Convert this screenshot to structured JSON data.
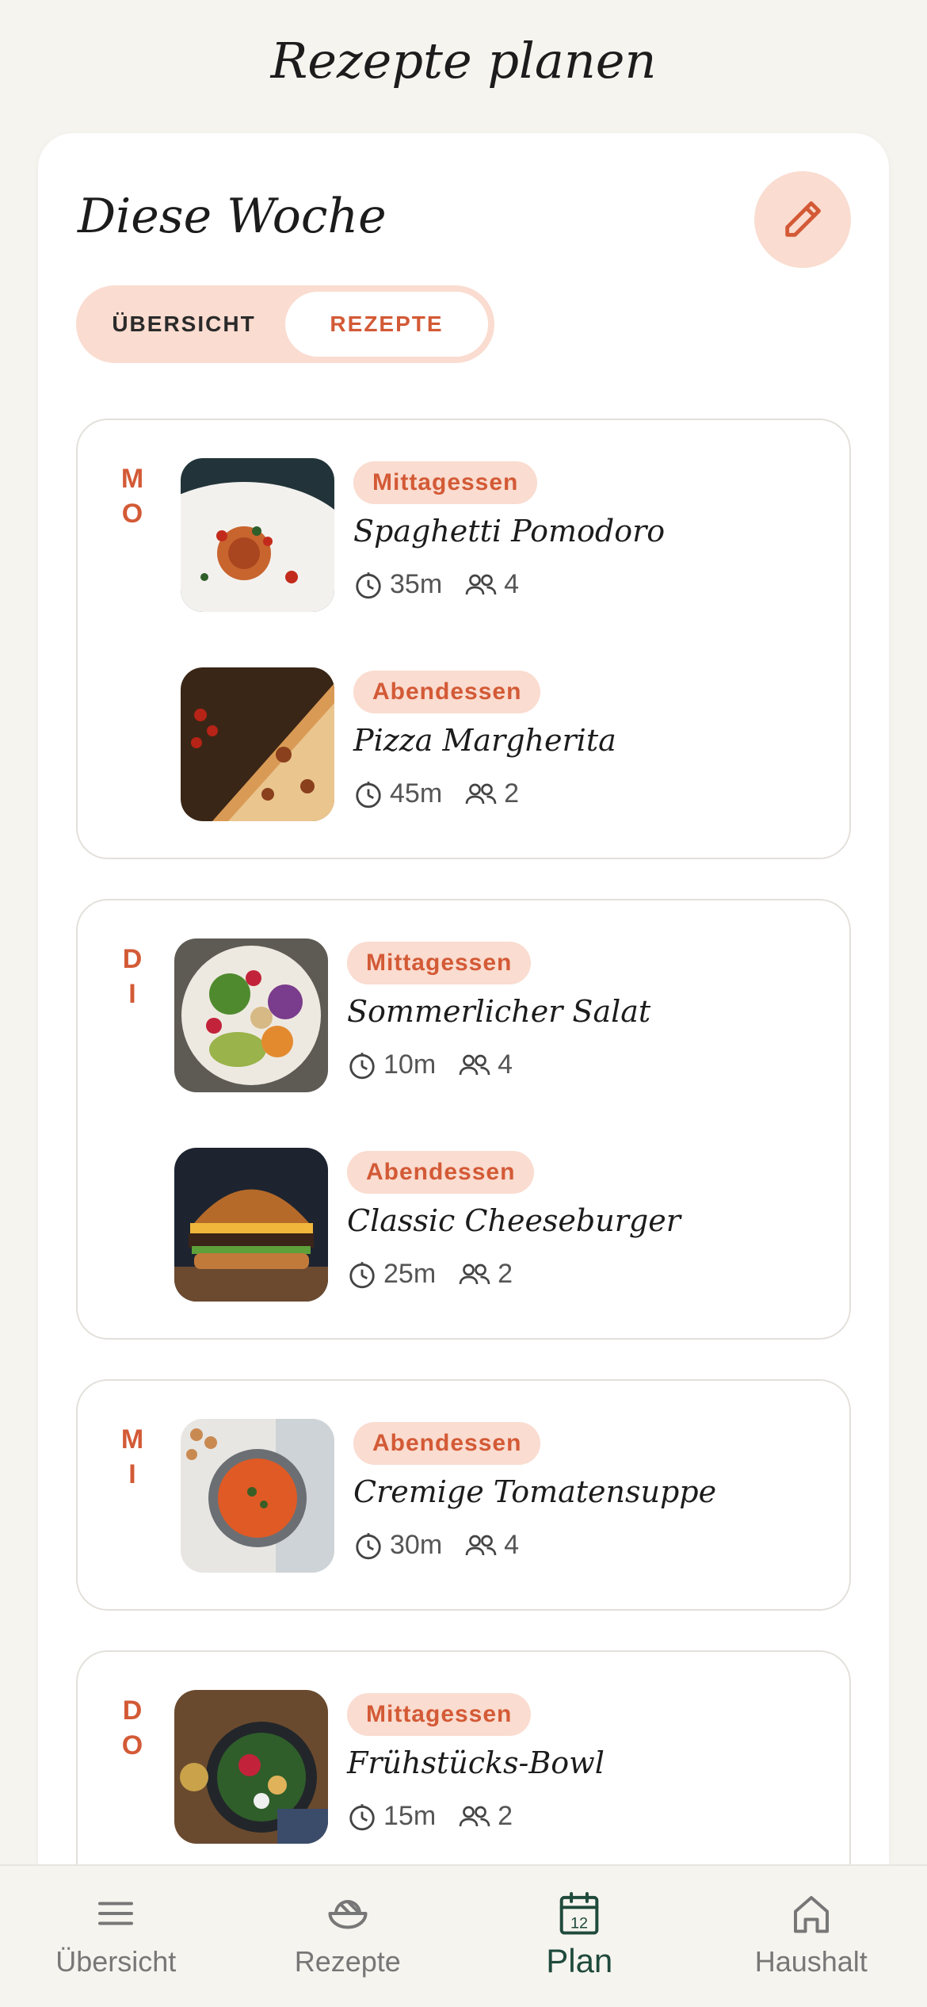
{
  "header": {
    "title": "Rezepte planen"
  },
  "week": {
    "title": "Diese Woche",
    "edit_icon": "pencil-icon",
    "segments": [
      {
        "label": "ÜBERSICHT",
        "active": false
      },
      {
        "label": "REZEPTE",
        "active": true
      }
    ]
  },
  "days": [
    {
      "label": "MO",
      "meals": [
        {
          "type": "Mittagessen",
          "name": "Spaghetti Pomodoro",
          "time": "35m",
          "servings": "4"
        },
        {
          "type": "Abendessen",
          "name": "Pizza Margherita",
          "time": "45m",
          "servings": "2"
        }
      ]
    },
    {
      "label": "DI",
      "meals": [
        {
          "type": "Mittagessen",
          "name": "Sommerlicher Salat",
          "time": "10m",
          "servings": "4"
        },
        {
          "type": "Abendessen",
          "name": "Classic Cheeseburger",
          "time": "25m",
          "servings": "2"
        }
      ]
    },
    {
      "label": "MI",
      "meals": [
        {
          "type": "Abendessen",
          "name": "Cremige Tomatensuppe",
          "time": "30m",
          "servings": "4"
        }
      ]
    },
    {
      "label": "DO",
      "meals": [
        {
          "type": "Mittagessen",
          "name": "Frühstücks-Bowl",
          "time": "15m",
          "servings": "2"
        }
      ]
    }
  ],
  "tabbar": {
    "items": [
      {
        "label": "Übersicht",
        "icon": "menu-icon",
        "active": false
      },
      {
        "label": "Rezepte",
        "icon": "bowl-icon",
        "active": false
      },
      {
        "label": "Plan",
        "icon": "calendar-icon",
        "calendar_day": "12",
        "active": true
      },
      {
        "label": "Haushalt",
        "icon": "home-icon",
        "active": false
      }
    ]
  },
  "colors": {
    "accent": "#d35a36",
    "accent_soft": "#fadcd0",
    "active_tab": "#1f4a3c",
    "background": "#f6f4ef"
  }
}
